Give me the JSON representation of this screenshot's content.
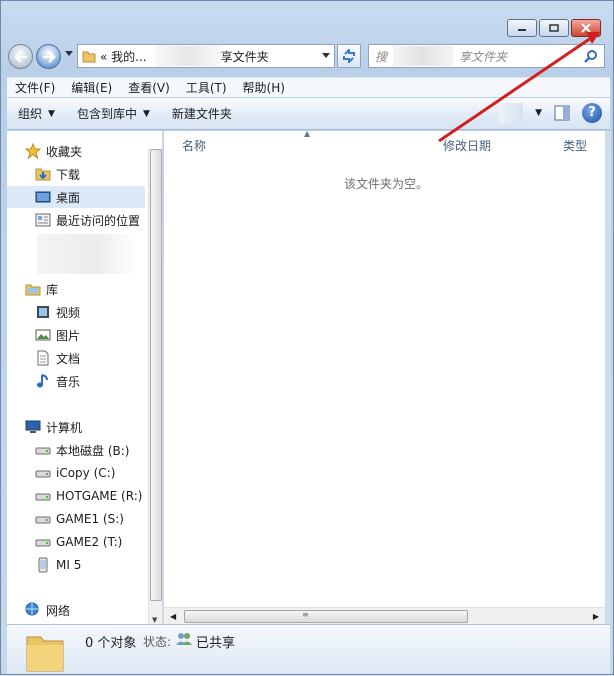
{
  "window": {
    "minimize_icon": "minimize-icon",
    "maximize_icon": "maximize-icon",
    "close_icon": "close-icon",
    "close_color": "#c94731"
  },
  "address": {
    "crumb1": "«  我的...",
    "crumb2": "享文件夹"
  },
  "search": {
    "placeholder_start": "搜",
    "placeholder_end": "享文件夹"
  },
  "menu": [
    "文件(F)",
    "编辑(E)",
    "查看(V)",
    "工具(T)",
    "帮助(H)"
  ],
  "commands": {
    "organize": "组织",
    "include_in_library": "包含到库中",
    "new_folder": "新建文件夹"
  },
  "sidebar": {
    "favorites": {
      "label": "收藏夹",
      "items": [
        "下载",
        "桌面",
        "最近访问的位置"
      ]
    },
    "libraries": {
      "label": "库",
      "items": [
        "视频",
        "图片",
        "文档",
        "音乐"
      ]
    },
    "computer": {
      "label": "计算机",
      "items": [
        "本地磁盘 (B:)",
        "iCopy (C:)",
        "HOTGAME (R:)",
        "GAME1 (S:)",
        "GAME2 (T:)",
        "MI 5"
      ]
    },
    "network": {
      "label": "网络"
    }
  },
  "columns": {
    "name": "名称",
    "modified": "修改日期",
    "type": "类型"
  },
  "content": {
    "empty_message": "该文件夹为空。"
  },
  "status": {
    "count": "0 个对象",
    "state_label": "状态:",
    "shared": "已共享"
  },
  "annotation": {
    "arrow_color": "#d21f1f"
  }
}
